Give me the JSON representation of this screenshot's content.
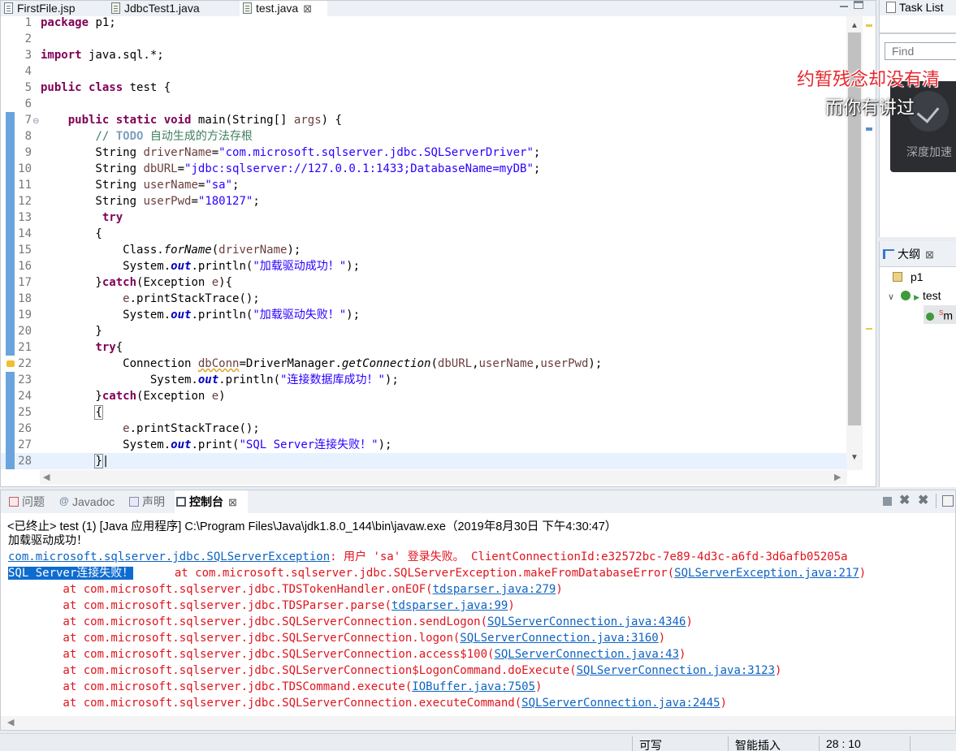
{
  "editor": {
    "tabs": [
      {
        "label": "FirstFile.jsp",
        "active": false
      },
      {
        "label": "JdbcTest1.java",
        "active": false
      },
      {
        "label": "test.java",
        "active": true
      }
    ],
    "close_glyph": "⊠",
    "lines": [
      {
        "n": "1",
        "text": "package p1;"
      },
      {
        "n": "2",
        "text": ""
      },
      {
        "n": "3",
        "text": "import java.sql.*;"
      },
      {
        "n": "4",
        "text": ""
      },
      {
        "n": "5",
        "text": "public class test {"
      },
      {
        "n": "6",
        "text": ""
      },
      {
        "n": "7",
        "text": "    public static void main(String[] args) {"
      },
      {
        "n": "8",
        "text": "        // TODO 自动生成的方法存根"
      },
      {
        "n": "9",
        "text": "        String driverName=\"com.microsoft.sqlserver.jdbc.SQLServerDriver\";"
      },
      {
        "n": "10",
        "text": "        String dbURL=\"jdbc:sqlserver://127.0.0.1:1433;DatabaseName=myDB\";"
      },
      {
        "n": "11",
        "text": "        String userName=\"sa\";"
      },
      {
        "n": "12",
        "text": "        String userPwd=\"180127\";"
      },
      {
        "n": "13",
        "text": "         try"
      },
      {
        "n": "14",
        "text": "        {"
      },
      {
        "n": "15",
        "text": "            Class.forName(driverName);"
      },
      {
        "n": "16",
        "text": "            System.out.println(\"加载驱动成功！\");"
      },
      {
        "n": "17",
        "text": "        }catch(Exception e){"
      },
      {
        "n": "18",
        "text": "            e.printStackTrace();"
      },
      {
        "n": "19",
        "text": "            System.out.println(\"加载驱动失败！\");"
      },
      {
        "n": "20",
        "text": "        }"
      },
      {
        "n": "21",
        "text": "        try{"
      },
      {
        "n": "22",
        "text": "            Connection dbConn=DriverManager.getConnection(dbURL,userName,userPwd);"
      },
      {
        "n": "23",
        "text": "                System.out.println(\"连接数据库成功！\");"
      },
      {
        "n": "24",
        "text": "        }catch(Exception e)"
      },
      {
        "n": "25",
        "text": "        {"
      },
      {
        "n": "26",
        "text": "            e.printStackTrace();"
      },
      {
        "n": "27",
        "text": "            System.out.print(\"SQL Server连接失败！\");"
      },
      {
        "n": "28",
        "text": "        }"
      }
    ]
  },
  "task_list": {
    "title": "Task List",
    "find_placeholder": "Find"
  },
  "outline": {
    "title": "大纲",
    "items": [
      {
        "label": "p1"
      },
      {
        "label": "test"
      },
      {
        "label": "m"
      }
    ],
    "static_mark": "S"
  },
  "overlay": {
    "line1": "约暂残念却没有清",
    "line2": "而你有讲过",
    "speed_label": "深度加速"
  },
  "console": {
    "tabs": [
      {
        "label": "问题",
        "active": false
      },
      {
        "label": "Javadoc",
        "active": false,
        "glyph": "@"
      },
      {
        "label": "声明",
        "active": false
      },
      {
        "label": "控制台",
        "active": true
      }
    ],
    "header": "<已终止> test (1) [Java 应用程序] C:\\Program Files\\Java\\jdk1.8.0_144\\bin\\javaw.exe（2019年8月30日 下午4:30:47）",
    "output": {
      "l1": "加载驱动成功！",
      "l2_link": "com.microsoft.sqlserver.jdbc.SQLServerException",
      "l2_rest": ": 用户 'sa' 登录失败。 ClientConnectionId:e32572bc-7e89-4d3c-a6fd-3d6afb05205a",
      "l3_sel": "SQL Server连接失败！",
      "l3_mid": "      at com.microsoft.sqlserver.jdbc.SQLServerException.makeFromDatabaseError(",
      "l3_link": "SQLServerException.java:217",
      "stack": [
        {
          "pre": "        at com.microsoft.sqlserver.jdbc.TDSTokenHandler.onEOF(",
          "link": "tdsparser.java:279"
        },
        {
          "pre": "        at com.microsoft.sqlserver.jdbc.TDSParser.parse(",
          "link": "tdsparser.java:99"
        },
        {
          "pre": "        at com.microsoft.sqlserver.jdbc.SQLServerConnection.sendLogon(",
          "link": "SQLServerConnection.java:4346"
        },
        {
          "pre": "        at com.microsoft.sqlserver.jdbc.SQLServerConnection.logon(",
          "link": "SQLServerConnection.java:3160"
        },
        {
          "pre": "        at com.microsoft.sqlserver.jdbc.SQLServerConnection.access$100(",
          "link": "SQLServerConnection.java:43"
        },
        {
          "pre": "        at com.microsoft.sqlserver.jdbc.SQLServerConnection$LogonCommand.doExecute(",
          "link": "SQLServerConnection.java:3123"
        },
        {
          "pre": "        at com.microsoft.sqlserver.jdbc.TDSCommand.execute(",
          "link": "IOBuffer.java:7505"
        },
        {
          "pre": "        at com.microsoft.sqlserver.jdbc.SQLServerConnection.executeCommand(",
          "link": "SQLServerConnection.java:2445"
        }
      ],
      "close_paren": ")"
    }
  },
  "statusbar": {
    "writable": "可写",
    "insert_mode": "智能插入",
    "position": "28 : 10"
  },
  "colors": {
    "keyword": "#7f0055",
    "string": "#2a00ff",
    "error": "#e0141e",
    "link": "#0e63c2",
    "selection": "#0e6cd0"
  }
}
